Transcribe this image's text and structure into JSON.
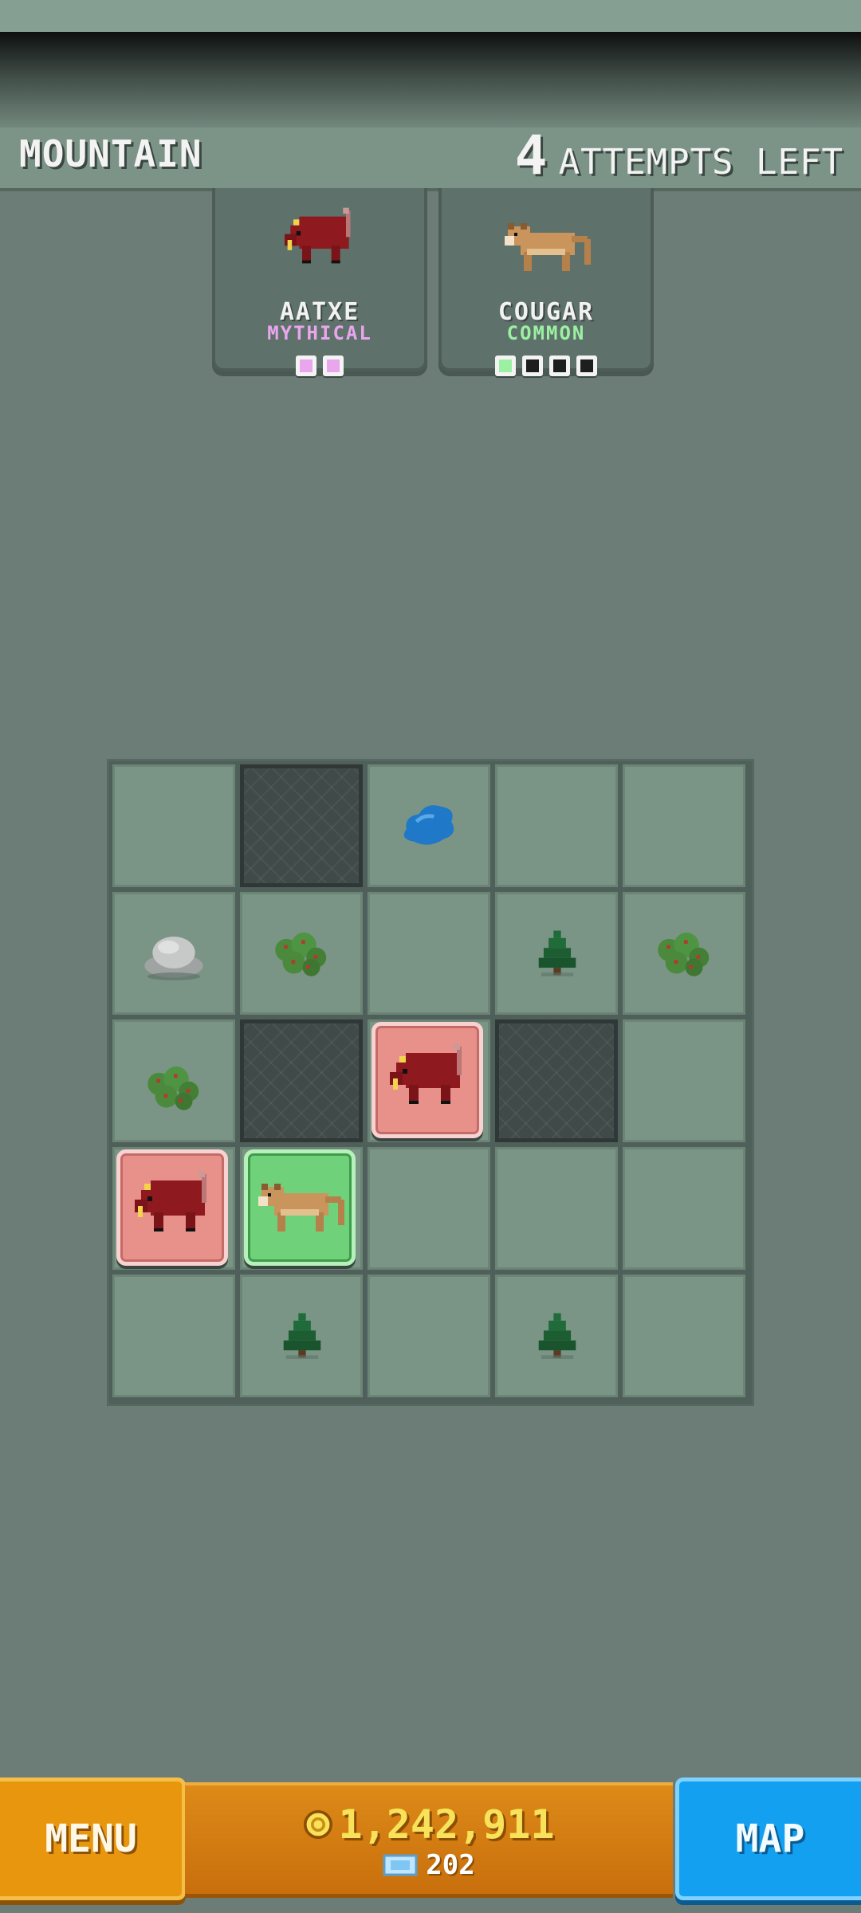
{
  "header": {
    "biome": "MOUNTAIN",
    "attempts_number": "4",
    "attempts_label": "ATTEMPTS LEFT"
  },
  "cards": [
    {
      "name": "AATXE",
      "rarity": "MYTHICAL",
      "rarity_color": "#e9a6ec",
      "pips_filled": 2,
      "pips_total": 2,
      "pip_color": "#e9a6ec"
    },
    {
      "name": "COUGAR",
      "rarity": "COMMON",
      "rarity_color": "#9cf0a2",
      "pips_filled": 1,
      "pips_total": 4,
      "pip_color": "#9cf0a2"
    }
  ],
  "board": {
    "rows": [
      [
        "empty",
        "blocked",
        "water",
        "empty",
        "empty"
      ],
      [
        "rock",
        "bush",
        "empty",
        "tree",
        "bush"
      ],
      [
        "bush",
        "blocked",
        "aatxe",
        "blocked",
        "empty"
      ],
      [
        "aatxe",
        "cougar",
        "empty",
        "empty",
        "empty"
      ],
      [
        "empty",
        "tree",
        "empty",
        "tree",
        "empty"
      ]
    ]
  },
  "footer": {
    "menu_label": "MENU",
    "coins": "1,242,911",
    "gems": "202",
    "map_label": "MAP"
  },
  "colors": {
    "background": "#6b7d76",
    "aatxe_tile": "#e8908a",
    "cougar_tile": "#6fd17a",
    "menu_button": "#e8960e",
    "map_button": "#13a0f0",
    "coin_text": "#f7e25a"
  }
}
